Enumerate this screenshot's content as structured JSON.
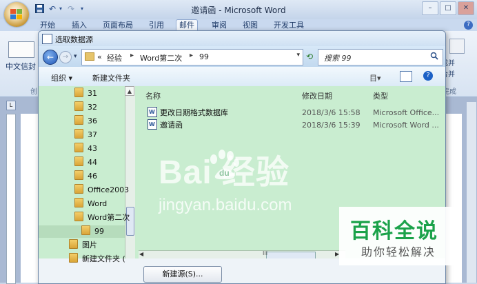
{
  "word": {
    "title": "邀请函 - Microsoft Word",
    "tabs": [
      "开始",
      "插入",
      "页面布局",
      "引用",
      "邮件",
      "审阅",
      "视图",
      "开发工具"
    ],
    "active_tab": "邮件",
    "left_button_label": "中文信封",
    "left_group_label": "创",
    "right_label1": "成并",
    "right_label2": "合并",
    "right_group_label": "完成",
    "help": "?"
  },
  "dialog": {
    "title": "选取数据源",
    "address": {
      "prefix": "«",
      "crumbs": [
        "经验",
        "Word第二次",
        "99"
      ],
      "sep": "▸"
    },
    "search_placeholder": "搜索 99",
    "toolbar": {
      "organize": "组织 ▾",
      "new_folder": "新建文件夹",
      "more": "目▾"
    },
    "tree": [
      {
        "label": "31",
        "sel": false
      },
      {
        "label": "32",
        "sel": false
      },
      {
        "label": "36",
        "sel": false
      },
      {
        "label": "37",
        "sel": false
      },
      {
        "label": "43",
        "sel": false
      },
      {
        "label": "44",
        "sel": false
      },
      {
        "label": "46",
        "sel": false
      },
      {
        "label": "Office2003",
        "sel": false
      },
      {
        "label": "Word",
        "sel": false
      },
      {
        "label": "Word第二次",
        "sel": false
      },
      {
        "label": "99",
        "sel": true
      },
      {
        "label": "图片",
        "sel": false
      },
      {
        "label": "新建文件夹 (",
        "sel": false
      }
    ],
    "columns": {
      "name": "名称",
      "date": "修改日期",
      "type": "类型"
    },
    "files": [
      {
        "name": "更改日期格式数据库",
        "date": "2018/3/6 15:58",
        "type": "Microsoft Office..."
      },
      {
        "name": "邀请函",
        "date": "2018/3/6 15:39",
        "type": "Microsoft Word ..."
      }
    ],
    "new_source_button": "新建源(S)...",
    "hscroll_mid": "III"
  },
  "watermark": {
    "baidu": "Bai  经验",
    "baidu_du": "du",
    "baidu_sub": "jingyan.baidu.com",
    "baike_title": "百科全说",
    "baike_sub": "助你轻松解决"
  },
  "icons": {
    "office_button": "office-logo-icon",
    "save": "save-icon",
    "undo": "undo-icon",
    "redo": "redo-icon",
    "back": "back-arrow-icon",
    "forward": "forward-arrow-icon",
    "refresh": "refresh-icon",
    "search": "search-icon",
    "folder": "folder-icon",
    "word_doc": "word-document-icon"
  }
}
